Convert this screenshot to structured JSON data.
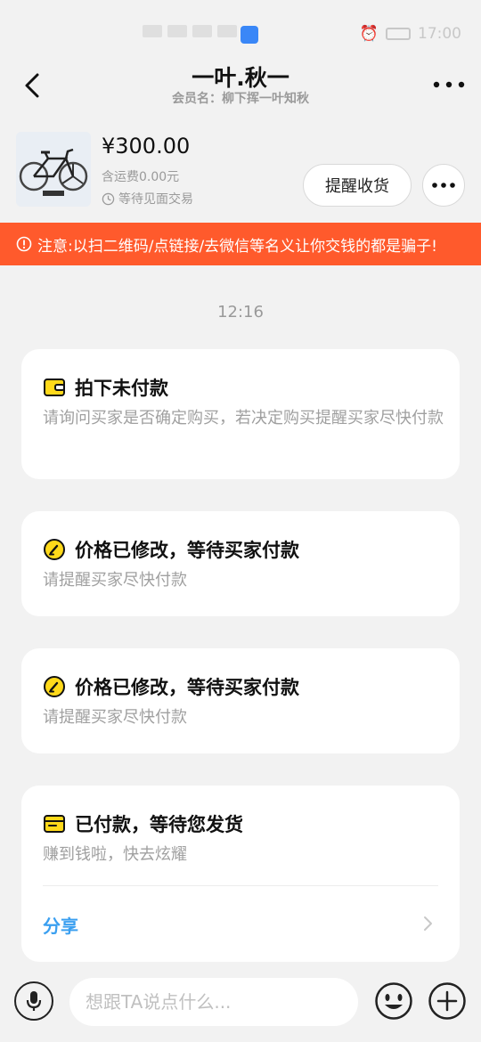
{
  "status_bar": {
    "time": "17:00"
  },
  "header": {
    "title": "一叶.秋一",
    "subtitle": "会员名：柳下挥一叶知秋"
  },
  "product": {
    "price": "¥300.00",
    "shipping": "含运费0.00元",
    "trade_status": "等待见面交易",
    "remind_label": "提醒收货"
  },
  "warning": {
    "text": "注意:以扫二维码/点链接/去微信等名义让你交钱的都是骗子!"
  },
  "timestamp": "12:16",
  "cards": [
    {
      "title": "拍下未付款",
      "desc": "请询问买家是否确定购买，若决定购买提醒买家尽快付款"
    },
    {
      "title": "价格已修改，等待买家付款",
      "desc": "请提醒买家尽快付款"
    },
    {
      "title": "价格已修改，等待买家付款",
      "desc": "请提醒买家尽快付款"
    },
    {
      "title": "已付款，等待您发货",
      "desc": "赚到钱啦，快去炫耀",
      "action": "分享"
    }
  ],
  "input": {
    "placeholder": "想跟TA说点什么..."
  },
  "colors": {
    "accent_yellow": "#ffd91a",
    "warning_bg": "#ff5a2c",
    "link_blue": "#3a9ff0"
  }
}
